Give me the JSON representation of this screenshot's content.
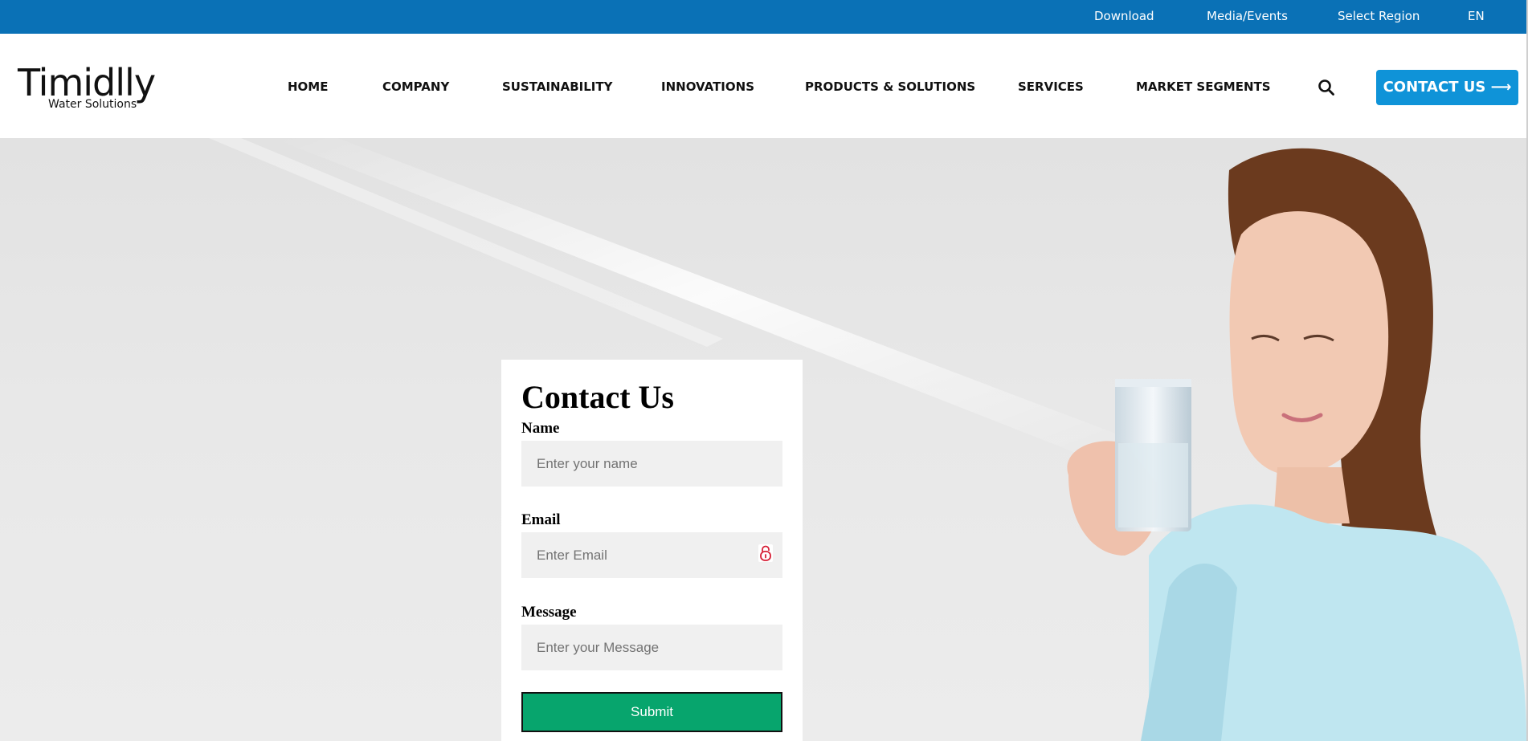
{
  "topbar": {
    "links": [
      "Download",
      "Media/Events",
      "Select Region",
      "EN"
    ]
  },
  "brand": {
    "name": "Timidlly",
    "tagline": "Water Solutions"
  },
  "nav": {
    "items": [
      "HOME",
      "COMPANY",
      "SUSTAINABILITY",
      "INNOVATIONS",
      "PRODUCTS & SOLUTIONS",
      "SERVICES",
      "MARKET SEGMENTS"
    ],
    "cta_label": "CONTACT US ⟶"
  },
  "form": {
    "title": "Contact Us",
    "name_label": "Name",
    "name_placeholder": "Enter your name",
    "email_label": "Email",
    "email_placeholder": "Enter Email",
    "message_label": "Message",
    "message_placeholder": "Enter your Message",
    "submit_label": "Submit"
  },
  "colors": {
    "topbar": "#0a71b6",
    "cta": "#0f93d8",
    "submit": "#07a56d",
    "field": "#f0f0f0"
  },
  "icons": [
    "search-icon",
    "lock-icon"
  ]
}
